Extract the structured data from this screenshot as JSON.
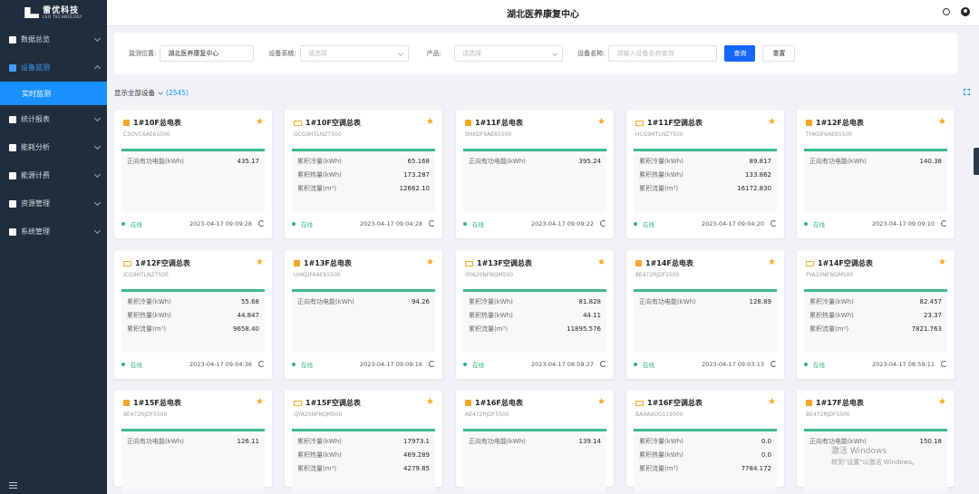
{
  "logo": {
    "main": "雷优科技",
    "sub": "LEO TECHNOLOGY"
  },
  "sidebar": {
    "items": [
      {
        "label": "数据总览",
        "icon": "bar-chart-icon"
      },
      {
        "label": "设备监测",
        "icon": "monitor-icon",
        "active": true,
        "sub": "实时监测"
      },
      {
        "label": "统计报表",
        "icon": "report-icon"
      },
      {
        "label": "能耗分析",
        "icon": "analysis-icon"
      },
      {
        "label": "能源计费",
        "icon": "billing-icon"
      },
      {
        "label": "资源管理",
        "icon": "grid-icon"
      },
      {
        "label": "系统管理",
        "icon": "gear-icon"
      }
    ]
  },
  "header": {
    "title": "湖北医养康复中心"
  },
  "filter": {
    "location_label": "监测位置:",
    "location_value": "湖北医养康复中心",
    "system_label": "设备系统:",
    "system_placeholder": "请选择",
    "product_label": "产品:",
    "product_placeholder": "请选择",
    "name_label": "设备名称:",
    "name_placeholder": "请输入设备名称查询",
    "query": "查询",
    "reset": "重置"
  },
  "summary": {
    "label": "显示全部设备",
    "count": "(2545)"
  },
  "status_online": "在线",
  "cards": [
    {
      "title": "1#10F总电表",
      "code": "C5OVC6AE65500",
      "type": "meter",
      "rows": [
        {
          "k": "正向有功电能(kWh)",
          "v": "435.17"
        }
      ],
      "time": "2023-04-17 09:09:28"
    },
    {
      "title": "1#10F空调总表",
      "code": "GCG9HTLNZ7500",
      "type": "ac",
      "rows": [
        {
          "k": "累积冷量(kWh)",
          "v": "65.168"
        },
        {
          "k": "累积热量(kWh)",
          "v": "173.287"
        },
        {
          "k": "累积流量(m³)",
          "v": "12662.10"
        }
      ],
      "time": "2023-04-17 09:04:28"
    },
    {
      "title": "1#11F总电表",
      "code": "SHKDF6AE65500",
      "type": "meter",
      "rows": [
        {
          "k": "正向有功电能(kWh)",
          "v": "395.24"
        }
      ],
      "time": "2023-04-17 09:09:22"
    },
    {
      "title": "1#11F空调总表",
      "code": "HCG9HTLNZ7500",
      "type": "ac",
      "rows": [
        {
          "k": "累积冷量(kWh)",
          "v": "89.817"
        },
        {
          "k": "累积热量(kWh)",
          "v": "133.862"
        },
        {
          "k": "累积流量(m³)",
          "v": "16172.830"
        }
      ],
      "time": "2023-04-17 09:04:20"
    },
    {
      "title": "1#12F总电表",
      "code": "THKDF6AE65500",
      "type": "meter",
      "rows": [
        {
          "k": "正向有功电能(kWh)",
          "v": "140.38"
        }
      ],
      "time": "2023-04-17 09:09:10"
    },
    {
      "title": "1#12F空调总表",
      "code": "ICG9HTLNZ7500",
      "type": "ac",
      "rows": [
        {
          "k": "累积冷量(kWh)",
          "v": "55.68"
        },
        {
          "k": "累积热量(kWh)",
          "v": "44.847"
        },
        {
          "k": "累积流量(m³)",
          "v": "9658.40"
        }
      ],
      "time": "2023-04-17 09:04:36"
    },
    {
      "title": "1#13F总电表",
      "code": "UHKDF6AE65500",
      "type": "meter",
      "rows": [
        {
          "k": "正向有功电能(kWh)",
          "v": "94.26"
        }
      ],
      "time": "2023-04-17 09:09:16"
    },
    {
      "title": "1#13F空调总表",
      "code": "OYA20NFNQM500",
      "type": "ac",
      "rows": [
        {
          "k": "累积冷量(kWh)",
          "v": "81.828"
        },
        {
          "k": "累积热量(kWh)",
          "v": "44.11"
        },
        {
          "k": "累积流量(m³)",
          "v": "11895.576"
        }
      ],
      "time": "2023-04-17 08:59:27"
    },
    {
      "title": "1#14F总电表",
      "code": "8E472RJDF5500",
      "type": "meter",
      "rows": [
        {
          "k": "正向有功电能(kWh)",
          "v": "128.89"
        }
      ],
      "time": "2023-04-17 09:03:13"
    },
    {
      "title": "1#14F空调总表",
      "code": "PYA20NFNQM500",
      "type": "ac",
      "rows": [
        {
          "k": "累积冷量(kWh)",
          "v": "82.457"
        },
        {
          "k": "累积热量(kWh)",
          "v": "23.37"
        },
        {
          "k": "累积流量(m³)",
          "v": "7821.763"
        }
      ],
      "time": "2023-04-17 08:59:11"
    },
    {
      "title": "1#15F总电表",
      "code": "9E472RJDF5500",
      "type": "meter",
      "rows": [
        {
          "k": "正向有功电能(kWh)",
          "v": "126.11"
        }
      ],
      "time": ""
    },
    {
      "title": "1#15F空调总表",
      "code": "QYA20NFNQM500",
      "type": "ac",
      "rows": [
        {
          "k": "累积冷量(kWh)",
          "v": "17973.1"
        },
        {
          "k": "累积热量(kWh)",
          "v": "469.289"
        },
        {
          "k": "累积流量(m³)",
          "v": "4279.85"
        }
      ],
      "time": ""
    },
    {
      "title": "1#16F总电表",
      "code": "AE472RJDF5500",
      "type": "meter",
      "rows": [
        {
          "k": "正向有功电能(kWh)",
          "v": "139.14"
        }
      ],
      "time": ""
    },
    {
      "title": "1#16F空调总表",
      "code": "BAXA9OG119500",
      "type": "ac",
      "rows": [
        {
          "k": "累积冷量(kWh)",
          "v": "0.0"
        },
        {
          "k": "累积热量(kWh)",
          "v": "0.0"
        },
        {
          "k": "累积流量(m³)",
          "v": "7784.172"
        }
      ],
      "time": ""
    },
    {
      "title": "1#17F总电表",
      "code": "BE472RJDF5500",
      "type": "meter",
      "rows": [
        {
          "k": "正向有功电能(kWh)",
          "v": "150.18"
        }
      ],
      "time": ""
    }
  ],
  "watermark": {
    "line1": "激活 Windows",
    "line2": "转到\"设置\"以激活 Windows。"
  }
}
